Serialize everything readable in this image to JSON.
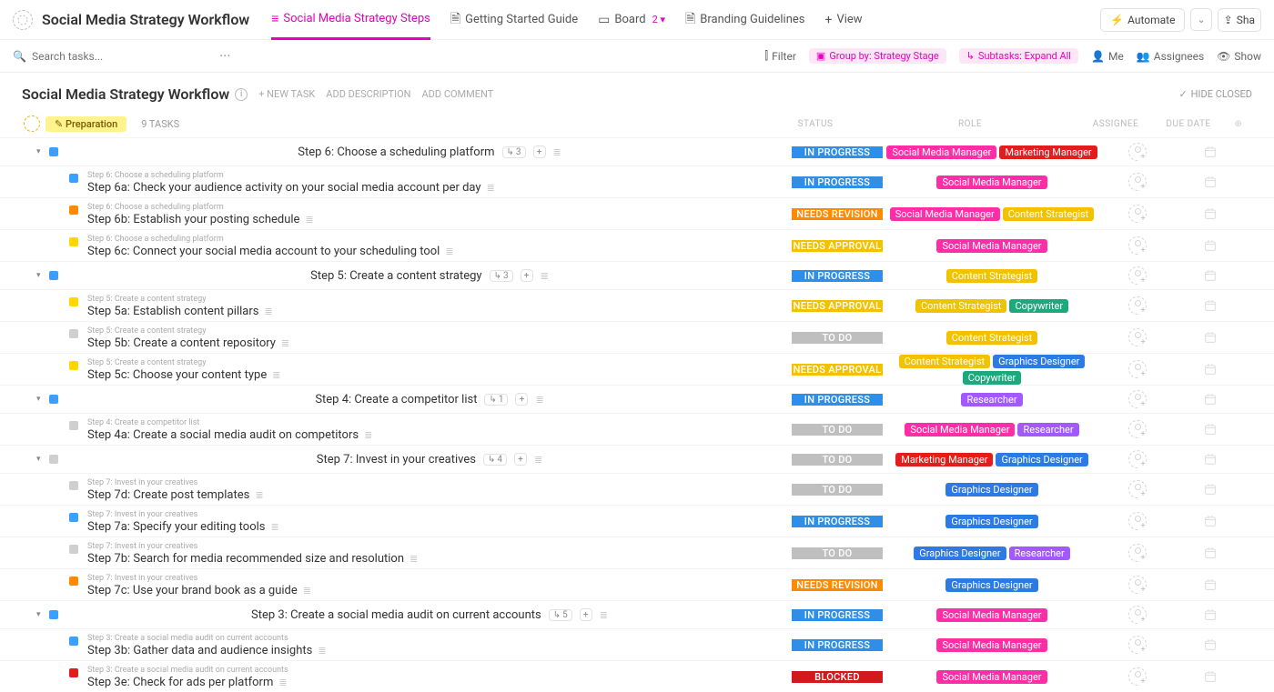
{
  "workspace_title": "Social Media Strategy Workflow",
  "topnav_tabs": [
    {
      "icon": "≡",
      "label": "Social Media Strategy Steps",
      "active": true
    },
    {
      "icon": "🗎",
      "label": "Getting Started Guide"
    },
    {
      "icon": "▭",
      "label": "Board",
      "badge": "2 ▾"
    },
    {
      "icon": "🗎",
      "label": "Branding Guidelines"
    },
    {
      "icon": "+",
      "label": "View"
    }
  ],
  "automate_label": "Automate",
  "share_label": "Sha",
  "search_placeholder": "Search tasks...",
  "toolbar": {
    "filter": "Filter",
    "group_by": "Group by: Strategy Stage",
    "subtasks": "Subtasks: Expand All",
    "me": "Me",
    "assignees": "Assignees",
    "show": "Show"
  },
  "page_title": "Social Media Strategy Workflow",
  "new_task": "+ NEW TASK",
  "add_description": "ADD DESCRIPTION",
  "add_comment": "ADD COMMENT",
  "hide_closed": "HIDE CLOSED",
  "group_name": "Preparation",
  "task_count_label": "9 TASKS",
  "column_headers": {
    "status": "STATUS",
    "role": "ROLE",
    "assignee": "ASSIGNEE",
    "due_date": "DUE DATE"
  },
  "status_colors": {
    "IN PROGRESS": "#2f8fe6",
    "NEEDS REVISION": "#ff8a00",
    "NEEDS APPROVAL": "#f2c200",
    "TO DO": "#bfbfbf",
    "BLOCKED": "#d3191c"
  },
  "square_for_status": {
    "IN PROGRESS": "sqc-blue",
    "NEEDS REVISION": "sqc-orange",
    "NEEDS APPROVAL": "sqc-yellow",
    "TO DO": "sqc-grey",
    "BLOCKED": "sqc-red"
  },
  "role_colors": {
    "Social Media Manager": "#ff2ea6",
    "Marketing Manager": "#e11d1d",
    "Content Strategist": "#f2c200",
    "Copywriter": "#1ea97c",
    "Graphics Designer": "#2c7be5",
    "Researcher": "#a259ff"
  },
  "tasks": [
    {
      "type": "parent",
      "name": "Step 6: Choose a scheduling platform",
      "sub_count": "3",
      "status": "IN PROGRESS",
      "roles": [
        "Social Media Manager",
        "Marketing Manager"
      ]
    },
    {
      "type": "sub",
      "crumb": "Step 6: Choose a scheduling platform",
      "name": "Step 6a: Check your audience activity on your social media account per day",
      "status": "IN PROGRESS",
      "roles": [
        "Social Media Manager"
      ]
    },
    {
      "type": "sub",
      "crumb": "Step 6: Choose a scheduling platform",
      "name": "Step 6b: Establish your posting schedule",
      "status": "NEEDS REVISION",
      "roles": [
        "Social Media Manager",
        "Content Strategist"
      ]
    },
    {
      "type": "sub",
      "crumb": "Step 6: Choose a scheduling platform",
      "name": "Step 6c: Connect your social media account to your scheduling tool",
      "status": "NEEDS APPROVAL",
      "roles": [
        "Social Media Manager"
      ]
    },
    {
      "type": "parent",
      "name": "Step 5: Create a content strategy",
      "sub_count": "3",
      "status": "IN PROGRESS",
      "roles": [
        "Content Strategist"
      ]
    },
    {
      "type": "sub",
      "crumb": "Step 5: Create a content strategy",
      "name": "Step 5a: Establish content pillars",
      "status": "NEEDS APPROVAL",
      "roles": [
        "Content Strategist",
        "Copywriter"
      ]
    },
    {
      "type": "sub",
      "crumb": "Step 5: Create a content strategy",
      "name": "Step 5b: Create a content repository",
      "status": "TO DO",
      "roles": [
        "Content Strategist"
      ]
    },
    {
      "type": "sub",
      "crumb": "Step 5: Create a content strategy",
      "name": "Step 5c: Choose your content type",
      "status": "NEEDS APPROVAL",
      "roles": [
        "Content Strategist",
        "Graphics Designer",
        "Copywriter"
      ]
    },
    {
      "type": "parent",
      "name": "Step 4: Create a competitor list",
      "sub_count": "1",
      "status": "IN PROGRESS",
      "roles": [
        "Researcher"
      ]
    },
    {
      "type": "sub",
      "crumb": "Step 4: Create a competitor list",
      "name": "Step 4a: Create a social media audit on competitors",
      "status": "TO DO",
      "roles": [
        "Social Media Manager",
        "Researcher"
      ]
    },
    {
      "type": "parent",
      "name": "Step 7: Invest in your creatives",
      "sub_count": "4",
      "status": "TO DO",
      "roles": [
        "Marketing Manager",
        "Graphics Designer"
      ]
    },
    {
      "type": "sub",
      "crumb": "Step 7: Invest in your creatives",
      "name": "Step 7d: Create post templates",
      "status": "TO DO",
      "roles": [
        "Graphics Designer"
      ]
    },
    {
      "type": "sub",
      "crumb": "Step 7: Invest in your creatives",
      "name": "Step 7a: Specify your editing tools",
      "status": "IN PROGRESS",
      "roles": [
        "Graphics Designer"
      ]
    },
    {
      "type": "sub",
      "crumb": "Step 7: Invest in your creatives",
      "name": "Step 7b: Search for media recommended size and resolution",
      "status": "TO DO",
      "roles": [
        "Graphics Designer",
        "Researcher"
      ]
    },
    {
      "type": "sub",
      "crumb": "Step 7: Invest in your creatives",
      "name": "Step 7c: Use your brand book as a guide",
      "status": "NEEDS REVISION",
      "roles": [
        "Graphics Designer"
      ]
    },
    {
      "type": "parent",
      "name": "Step 3: Create a social media audit on current accounts",
      "sub_count": "5",
      "status": "IN PROGRESS",
      "roles": [
        "Social Media Manager"
      ]
    },
    {
      "type": "sub",
      "crumb": "Step 3: Create a social media audit on current accounts",
      "name": "Step 3b: Gather data and audience insights",
      "status": "IN PROGRESS",
      "roles": [
        "Social Media Manager"
      ]
    },
    {
      "type": "sub",
      "crumb": "Step 3: Create a social media audit on current accounts",
      "name": "Step 3e: Check for ads per platform",
      "status": "BLOCKED",
      "roles": [
        "Social Media Manager"
      ]
    }
  ]
}
